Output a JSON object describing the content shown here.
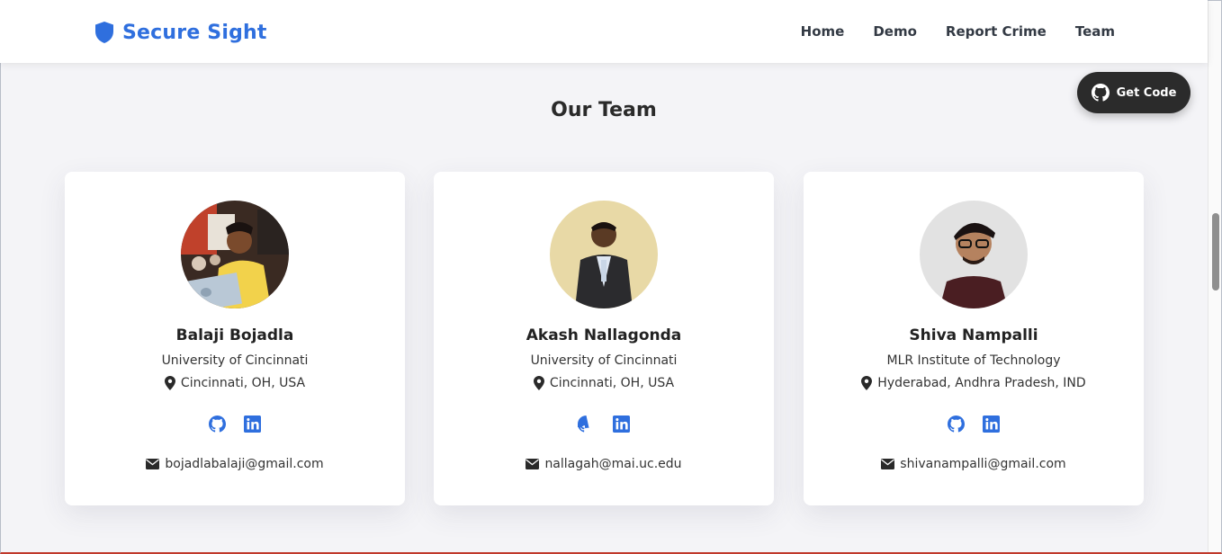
{
  "brand": {
    "name": "Secure Sight",
    "icon": "shield-icon",
    "color": "#2f6fde"
  },
  "nav": {
    "items": [
      {
        "label": "Home"
      },
      {
        "label": "Demo"
      },
      {
        "label": "Report Crime"
      },
      {
        "label": "Team"
      }
    ]
  },
  "get_code": {
    "label": "Get Code",
    "icon": "github-icon"
  },
  "team": {
    "title": "Our Team",
    "members": [
      {
        "name": "Balaji Bojadla",
        "org": "University of Cincinnati",
        "location": "Cincinnati, OH, USA",
        "email": "bojadlabalaji@gmail.com"
      },
      {
        "name": "Akash Nallagonda",
        "org": "University of Cincinnati",
        "location": "Cincinnati, OH, USA",
        "email": "nallagah@mai.uc.edu"
      },
      {
        "name": "Shiva Nampalli",
        "org": "MLR Institute of Technology",
        "location": "Hyderabad, Andhra Pradesh, IND",
        "email": "shivanampalli@gmail.com"
      }
    ],
    "social_icons": [
      "github-icon",
      "linkedin-icon"
    ]
  },
  "colors": {
    "accent": "#2f6fde",
    "button_dark": "#2b2b2b",
    "background": "#f4f4f7"
  }
}
